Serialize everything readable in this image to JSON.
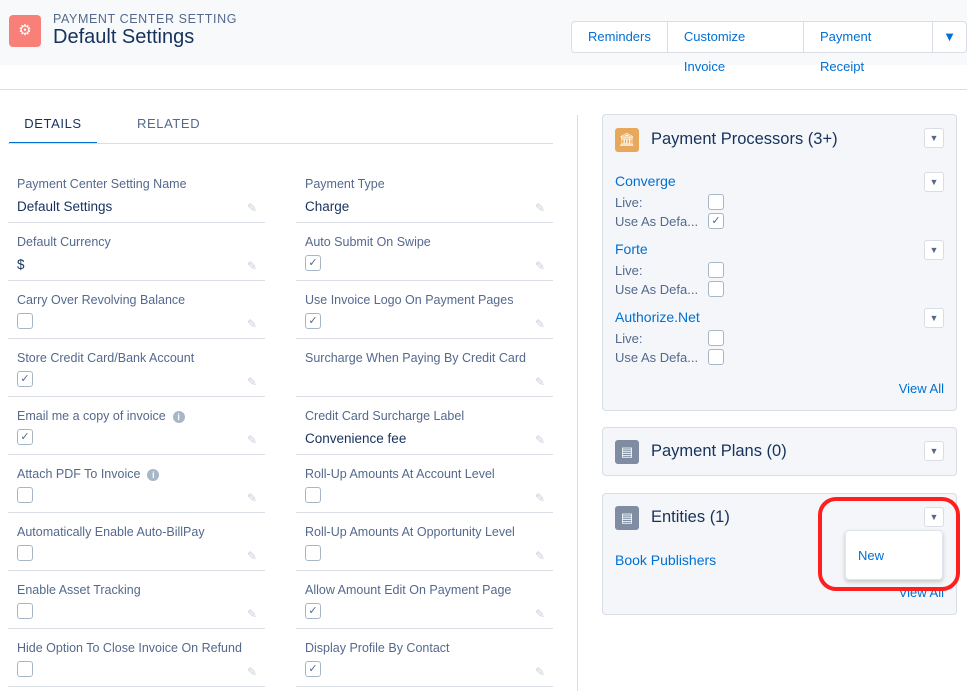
{
  "header": {
    "eyebrow": "PAYMENT CENTER SETTING",
    "title": "Default Settings",
    "buttons": [
      "Reminders",
      "Customize Invoice",
      "Payment Receipt"
    ],
    "more": "▼"
  },
  "tabs": {
    "details": "DETAILS",
    "related": "RELATED"
  },
  "fields": [
    {
      "label": "Payment Center Setting Name",
      "type": "text",
      "value": "Default Settings"
    },
    {
      "label": "Payment Type",
      "type": "text",
      "value": "Charge"
    },
    {
      "label": "Default Currency",
      "type": "text",
      "value": "$"
    },
    {
      "label": "Auto Submit On Swipe",
      "type": "checkbox",
      "checked": true
    },
    {
      "label": "Carry Over Revolving Balance",
      "type": "checkbox",
      "checked": false
    },
    {
      "label": "Use Invoice Logo On Payment Pages",
      "type": "checkbox",
      "checked": true
    },
    {
      "label": "Store Credit Card/Bank Account",
      "type": "checkbox",
      "checked": true
    },
    {
      "label": "Surcharge When Paying By Credit Card",
      "type": "text",
      "value": ""
    },
    {
      "label": "Email me a copy of invoice",
      "type": "checkbox",
      "checked": true,
      "info": true
    },
    {
      "label": "Credit Card Surcharge Label",
      "type": "text",
      "value": "Convenience fee"
    },
    {
      "label": "Attach PDF To Invoice",
      "type": "checkbox",
      "checked": false,
      "info": true
    },
    {
      "label": "Roll-Up Amounts At Account Level",
      "type": "checkbox",
      "checked": false
    },
    {
      "label": "Automatically Enable Auto-BillPay",
      "type": "checkbox",
      "checked": false
    },
    {
      "label": "Roll-Up Amounts At Opportunity Level",
      "type": "checkbox",
      "checked": false
    },
    {
      "label": "Enable Asset Tracking",
      "type": "checkbox",
      "checked": false
    },
    {
      "label": "Allow Amount Edit On Payment Page",
      "type": "checkbox",
      "checked": true
    },
    {
      "label": "Hide Option To Close Invoice On Refund",
      "type": "checkbox",
      "checked": false
    },
    {
      "label": "Display Profile By Contact",
      "type": "checkbox",
      "checked": true
    }
  ],
  "processors": {
    "title": "Payment Processors (3+)",
    "view_all": "View All",
    "live_label": "Live:",
    "default_label": "Use As Defa...",
    "items": [
      {
        "name": "Converge",
        "live": false,
        "default": true
      },
      {
        "name": "Forte",
        "live": false,
        "default": false
      },
      {
        "name": "Authorize.Net",
        "live": false,
        "default": false
      }
    ]
  },
  "plans": {
    "title": "Payment Plans (0)"
  },
  "entities": {
    "title": "Entities (1)",
    "item": "Book Publishers",
    "view_all": "View All",
    "menu_new": "New"
  },
  "colors": {
    "accent": "#0070d2",
    "highlight": "#ff1f1f"
  }
}
